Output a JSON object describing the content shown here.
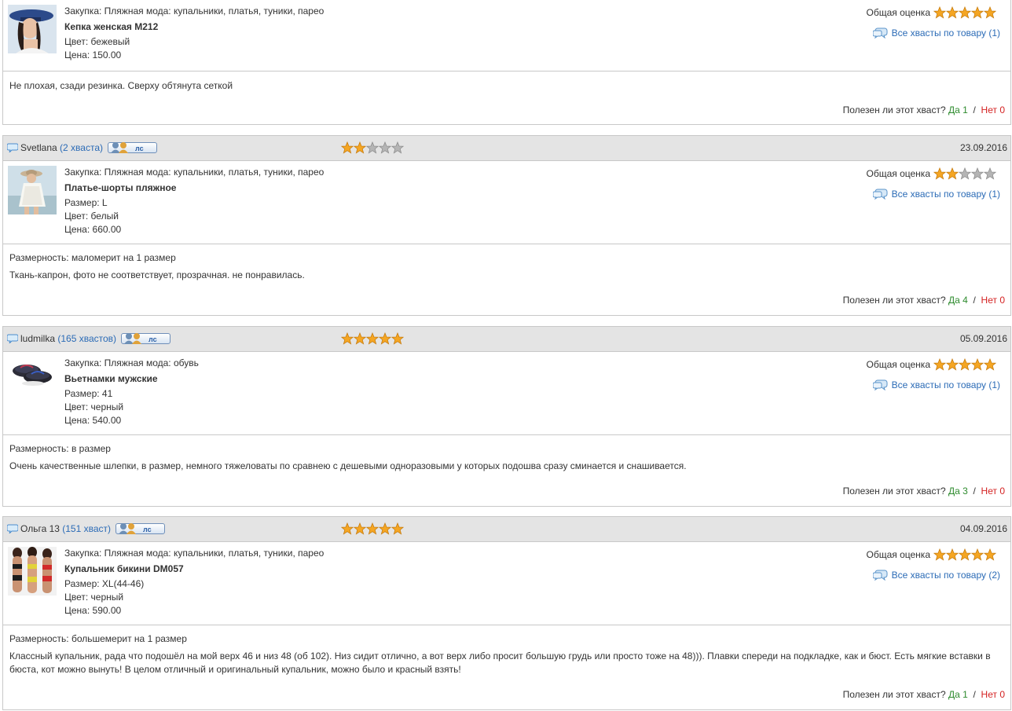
{
  "labels": {
    "overall": "Общая оценка",
    "helpful_q": "Полезен ли этот хваст?",
    "yes": "Да",
    "no": "Нет",
    "sep": "/",
    "pm": "лс",
    "purchase_prefix": "Закупка:",
    "size_prefix": "Размер:",
    "color_prefix": "Цвет:",
    "price_prefix": "Цена:",
    "fit_prefix": "Размерность:"
  },
  "colors": {
    "link": "#2b6bb6",
    "yes": "#2e8b2e",
    "no": "#d42222",
    "header_bg": "#e4e4e4",
    "star_on": "#f5a623",
    "star_off": "#b5b5b5"
  },
  "reviews": [
    {
      "has_header": false,
      "purchase": "Закупка: Пляжная мода: купальники, платья, туники, парео",
      "title": "Кепка женская М212",
      "size": "",
      "color": "Цвет: бежевый",
      "price": "Цена: 150.00",
      "overall_rating": 5,
      "all_reviews": "Все хвасты по товару (1)",
      "fit": "",
      "text": "Не плохая, сзади резинка. Сверху обтянута сеткой",
      "yes_count": "1",
      "no_count": "0",
      "thumb": "cap-photo"
    },
    {
      "has_header": true,
      "user": "Svetlana",
      "posts": "(2 хваста)",
      "rating": 2,
      "date": "23.09.2016",
      "purchase": "Закупка: Пляжная мода: купальники, платья, туники, парео",
      "title": "Платье-шорты пляжное",
      "size": "Размер: L",
      "color": "Цвет: белый",
      "price": "Цена: 660.00",
      "overall_rating": 2,
      "all_reviews": "Все хвасты по товару (1)",
      "fit": "Размерность: маломерит на 1 размер",
      "text": "Ткань-капрон, фото не соответствует, прозрачная. не понравилась.",
      "yes_count": "4",
      "no_count": "0",
      "thumb": "dress-photo"
    },
    {
      "has_header": true,
      "user": "ludmilka",
      "posts": "(165 хвастов)",
      "rating": 5,
      "date": "05.09.2016",
      "purchase": "Закупка: Пляжная мода: обувь",
      "title": "Вьетнамки мужские",
      "size": "Размер: 41",
      "color": "Цвет: черный",
      "price": "Цена: 540.00",
      "overall_rating": 5,
      "all_reviews": "Все хвасты по товару (1)",
      "fit": "Размерность: в размер",
      "text": "Очень качественные шлепки, в размер, немного тяжеловаты по сравнею с дешевыми одноразовыми у которых подошва сразу сминается и снашивается.",
      "yes_count": "3",
      "no_count": "0",
      "thumb": "flipflops-photo"
    },
    {
      "has_header": true,
      "user": "Ольга 13",
      "posts": "(151 хваст)",
      "rating": 5,
      "date": "04.09.2016",
      "purchase": "Закупка: Пляжная мода: купальники, платья, туники, парео",
      "title": "Купальник бикини DM057",
      "size": "Размер: XL(44-46)",
      "color": "Цвет: черный",
      "price": "Цена: 590.00",
      "overall_rating": 5,
      "all_reviews": "Все хвасты по товару (2)",
      "fit": "Размерность: большемерит на 1 размер",
      "text": "Классный купальник, рада что подошёл на мой верх 46 и низ 48 (об 102). Низ сидит отлично, а вот верх либо просит большую грудь или просто тоже на 48))). Плавки спереди на подкладке, как и бюст. Есть мягкие вставки в бюста, кот можно вынуть! В целом отличный и оригинальный купальник, можно было и красный взять!",
      "yes_count": "1",
      "no_count": "0",
      "thumb": "bikini-photo"
    }
  ]
}
